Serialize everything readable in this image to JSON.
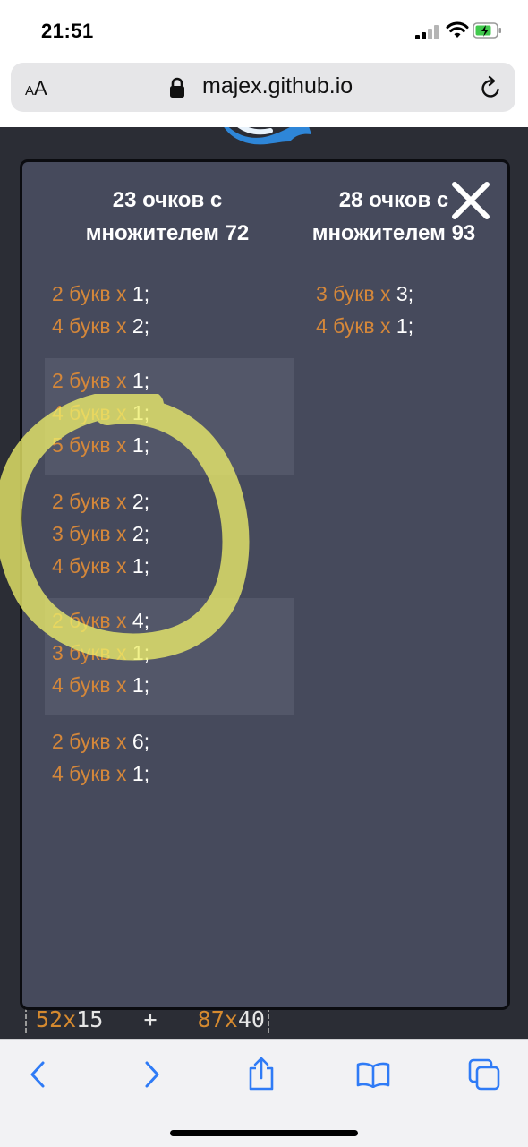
{
  "status": {
    "time": "21:51"
  },
  "browser": {
    "aa_small": "A",
    "aa_large": "A",
    "url": "majex.github.io"
  },
  "page_behind": {
    "left_num": "52",
    "left_mult": "15",
    "plus": "+",
    "right_num": "87",
    "right_mult": "40",
    "x": "x"
  },
  "modal": {
    "col1_header": {
      "line1": "23 очков с",
      "line2": "множителем 72"
    },
    "col2_header": {
      "line1": "28 очков с",
      "line2": "множителем 93"
    },
    "col1_groups": [
      {
        "lines": [
          {
            "prefix": "2 букв x ",
            "value": "1;"
          },
          {
            "prefix": "4 букв x ",
            "value": "2;"
          }
        ]
      },
      {
        "lines": [
          {
            "prefix": "2 букв x ",
            "value": "1;"
          },
          {
            "prefix": "4 букв x ",
            "value": "1;"
          },
          {
            "prefix": "5 букв x ",
            "value": "1;"
          }
        ]
      },
      {
        "lines": [
          {
            "prefix": "2 букв x ",
            "value": "2;"
          },
          {
            "prefix": "3 букв x ",
            "value": "2;"
          },
          {
            "prefix": "4 букв x ",
            "value": "1;"
          }
        ]
      },
      {
        "lines": [
          {
            "prefix": "2 букв x ",
            "value": "4;"
          },
          {
            "prefix": "3 букв x ",
            "value": "1;"
          },
          {
            "prefix": "4 букв x ",
            "value": "1;"
          }
        ]
      },
      {
        "lines": [
          {
            "prefix": "2 букв x ",
            "value": "6;"
          },
          {
            "prefix": "4 букв x ",
            "value": "1;"
          }
        ]
      }
    ],
    "col2_groups": [
      {
        "lines": [
          {
            "prefix": "3 букв x ",
            "value": "3;"
          },
          {
            "prefix": "4 букв x ",
            "value": "1;"
          }
        ]
      }
    ]
  },
  "colors": {
    "accent_orange": "#d4873a",
    "modal_bg": "#464a5c",
    "ios_blue": "#2f7bf6",
    "highlight_yellow": "#f1f17a"
  },
  "icons": [
    "signal-icon",
    "wifi-icon",
    "battery-icon",
    "lock-icon",
    "reload-icon",
    "close-icon",
    "back-icon",
    "forward-icon",
    "share-icon",
    "bookmarks-icon",
    "tabs-icon"
  ]
}
